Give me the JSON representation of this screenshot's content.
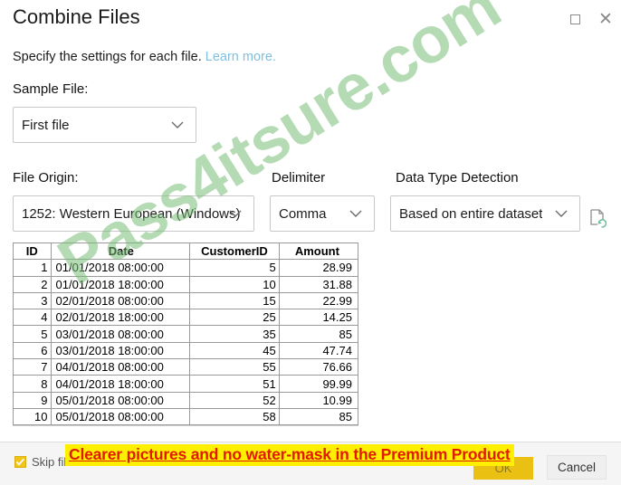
{
  "window": {
    "title": "Combine Files",
    "maximize_icon": "maximize-icon",
    "close_icon": "close-icon"
  },
  "subtitle": {
    "text": "Specify the settings for each file.",
    "link_text": "Learn more."
  },
  "fields": {
    "sample_file": {
      "label": "Sample File:",
      "value": "First file",
      "chevron_icon": "chevron-down-icon"
    },
    "file_origin": {
      "label": "File Origin:",
      "value": "1252: Western European (Windows)",
      "chevron_icon": "chevron-down-icon"
    },
    "delimiter": {
      "label": "Delimiter",
      "value": "Comma",
      "chevron_icon": "chevron-down-icon"
    },
    "data_type_detection": {
      "label": "Data Type Detection",
      "value": "Based on entire dataset",
      "chevron_icon": "chevron-down-icon"
    },
    "refresh_icon": "document-refresh-icon"
  },
  "preview": {
    "columns": [
      "ID",
      "Date",
      "CustomerID",
      "Amount"
    ],
    "rows": [
      [
        "1",
        "01/01/2018 08:00:00",
        "5",
        "28.99"
      ],
      [
        "2",
        "01/01/2018 18:00:00",
        "10",
        "31.88"
      ],
      [
        "3",
        "02/01/2018 08:00:00",
        "15",
        "22.99"
      ],
      [
        "4",
        "02/01/2018 18:00:00",
        "25",
        "14.25"
      ],
      [
        "5",
        "03/01/2018 08:00:00",
        "35",
        "85"
      ],
      [
        "6",
        "03/01/2018 18:00:00",
        "45",
        "47.74"
      ],
      [
        "7",
        "04/01/2018 08:00:00",
        "55",
        "76.66"
      ],
      [
        "8",
        "04/01/2018 18:00:00",
        "51",
        "99.99"
      ],
      [
        "9",
        "05/01/2018 08:00:00",
        "52",
        "10.99"
      ],
      [
        "10",
        "05/01/2018 08:00:00",
        "58",
        "85"
      ]
    ]
  },
  "footer": {
    "skip_files_label": "Skip files with errors",
    "skip_files_checked": true,
    "ok_label": "OK",
    "cancel_label": "Cancel"
  },
  "overlays": {
    "watermark_text": "Pass4itsure.com",
    "promo_banner_text": "Clearer pictures and no water-mask in the Premium Product"
  },
  "colors": {
    "link": "#7fbfdf",
    "checkbox": "#f0c419",
    "ok_button": "#eac112",
    "promo_background": "#ffef00",
    "promo_text": "#e01b00",
    "watermark": "#78be78"
  }
}
